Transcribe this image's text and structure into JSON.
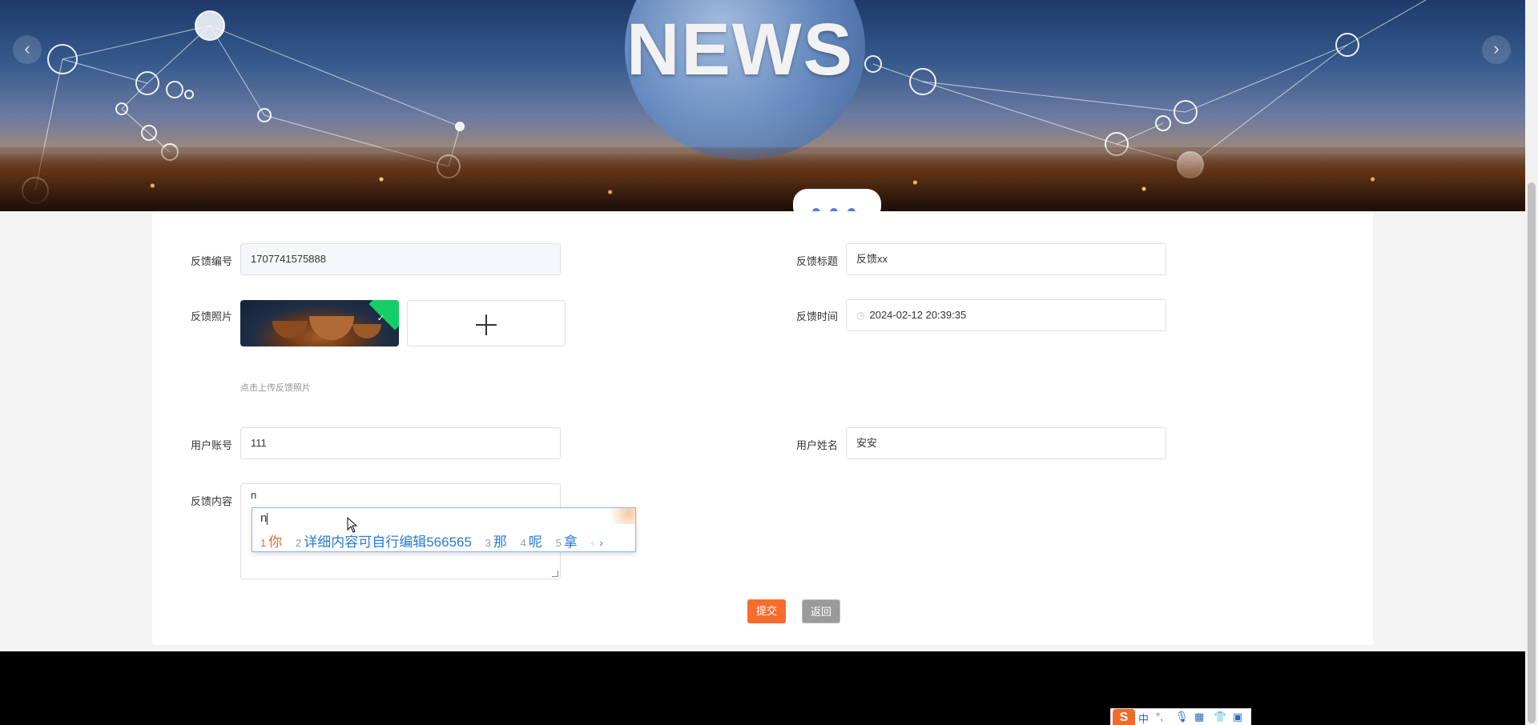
{
  "banner": {
    "headline": "NEWS",
    "prev_icon": "chevron-left-icon",
    "next_icon": "chevron-right-icon",
    "prev_glyph": "‹",
    "next_glyph": "›"
  },
  "form": {
    "feedback_no": {
      "label": "反馈编号",
      "value": "1707741575888"
    },
    "feedback_title": {
      "label": "反馈标题",
      "value": "反馈xx"
    },
    "feedback_photo": {
      "label": "反馈照片",
      "hint": "点击上传反馈照片"
    },
    "feedback_time": {
      "label": "反馈时间",
      "value": "2024-02-12 20:39:35"
    },
    "user_account": {
      "label": "用户账号",
      "value": "111"
    },
    "user_name": {
      "label": "用户姓名",
      "value": "安安"
    },
    "feedback_content": {
      "label": "反馈内容",
      "value": "n"
    }
  },
  "buttons": {
    "submit": "提交",
    "back": "返回"
  },
  "ime": {
    "composition": "n",
    "candidates": [
      {
        "n": "1",
        "text": "你"
      },
      {
        "n": "2",
        "text": "详细内容可自行编辑566565"
      },
      {
        "n": "3",
        "text": "那"
      },
      {
        "n": "4",
        "text": "呢"
      },
      {
        "n": "5",
        "text": "拿"
      }
    ],
    "prev": "‹",
    "next": "›"
  },
  "toolbar": {
    "logo": "S",
    "lang": "中"
  },
  "colors": {
    "accent": "#f56c2d",
    "back_button": "#9a9a9a",
    "success": "#13ce66",
    "ime_highlight": "#f0642a",
    "ime_candidate": "#2a7ad2"
  }
}
